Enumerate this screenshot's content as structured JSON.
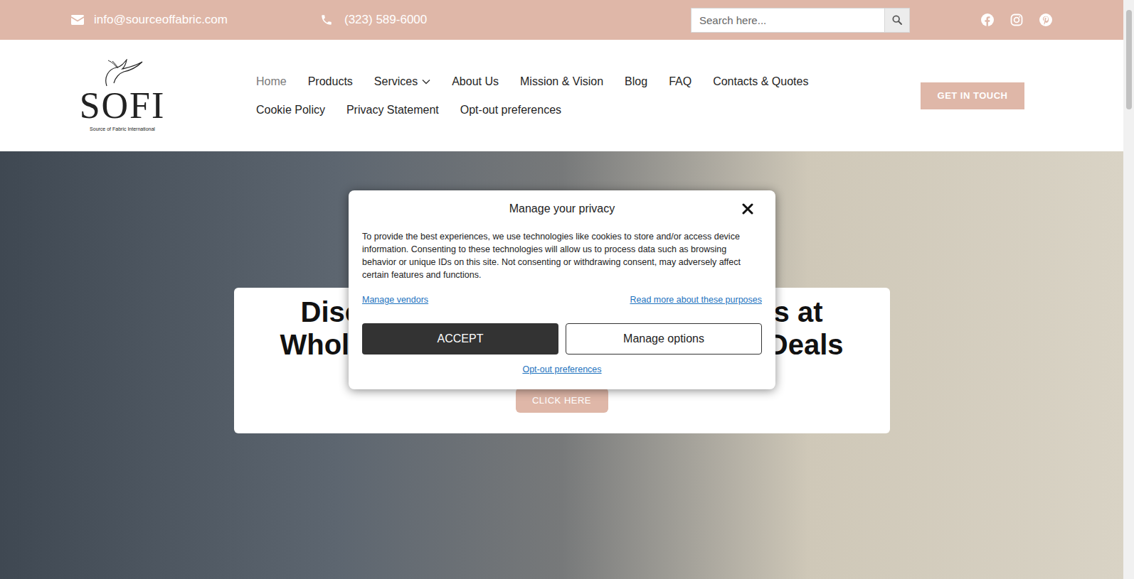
{
  "topbar": {
    "email": "info@sourceoffabric.com",
    "phone": "(323) 589-6000",
    "search": {
      "placeholder": "Search here..."
    }
  },
  "logo": {
    "text": "SOFI",
    "tagline": "Source of Fabric International"
  },
  "nav": [
    {
      "label": "Home",
      "selected": true,
      "has_submenu": false
    },
    {
      "label": "Products",
      "selected": false,
      "has_submenu": false
    },
    {
      "label": "Services",
      "selected": false,
      "has_submenu": true
    },
    {
      "label": "About Us",
      "selected": false,
      "has_submenu": false
    },
    {
      "label": "Mission & Vision",
      "selected": false,
      "has_submenu": false
    },
    {
      "label": "Blog",
      "selected": false,
      "has_submenu": false
    },
    {
      "label": "FAQ",
      "selected": false,
      "has_submenu": false
    },
    {
      "label": "Contacts & Quotes",
      "selected": false,
      "has_submenu": false
    },
    {
      "label": "Cookie Policy",
      "selected": false,
      "has_submenu": false
    },
    {
      "label": "Privacy Statement",
      "selected": false,
      "has_submenu": false
    },
    {
      "label": "Opt-out preferences",
      "selected": false,
      "has_submenu": false
    }
  ],
  "cta": "GET IN TOUCH",
  "hero": {
    "heading_lines": [
      {
        "left": "Disc",
        "right": "cs at"
      },
      {
        "left": "Whole",
        "right": "Deals"
      }
    ],
    "button": "CLICK HERE"
  },
  "consent": {
    "title": "Manage your privacy",
    "body": "To provide the best experiences, we use technologies like cookies to store and/or access device information. Consenting to these technologies will allow us to process data such as browsing behavior or unique IDs on this site. Not consenting or withdrawing consent, may adversely affect certain features and functions.",
    "vendors_link": "Manage vendors",
    "purposes_link": "Read more about these purposes",
    "accept": "ACCEPT",
    "manage": "Manage options",
    "optout": "Opt-out preferences"
  }
}
